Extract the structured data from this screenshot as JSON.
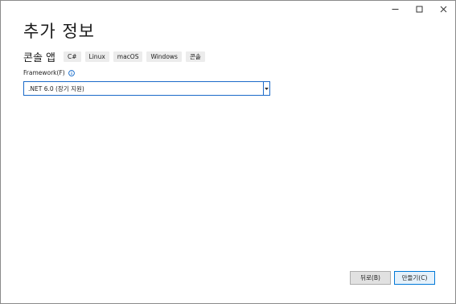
{
  "window": {
    "controls": [
      "minimize",
      "maximize",
      "close"
    ]
  },
  "header": {
    "title": "추가 정보",
    "subtitle": "콘솔 앱",
    "tags": [
      "C#",
      "Linux",
      "macOS",
      "Windows",
      "콘솔"
    ]
  },
  "framework": {
    "label": "Framework(F)",
    "selected": ".NET 6.0 (장기 지원)"
  },
  "footer": {
    "back_label": "뒤로(B)",
    "create_label": "만들기(C)"
  },
  "colors": {
    "accent": "#1b6ac9",
    "info": "#0a64c8"
  }
}
